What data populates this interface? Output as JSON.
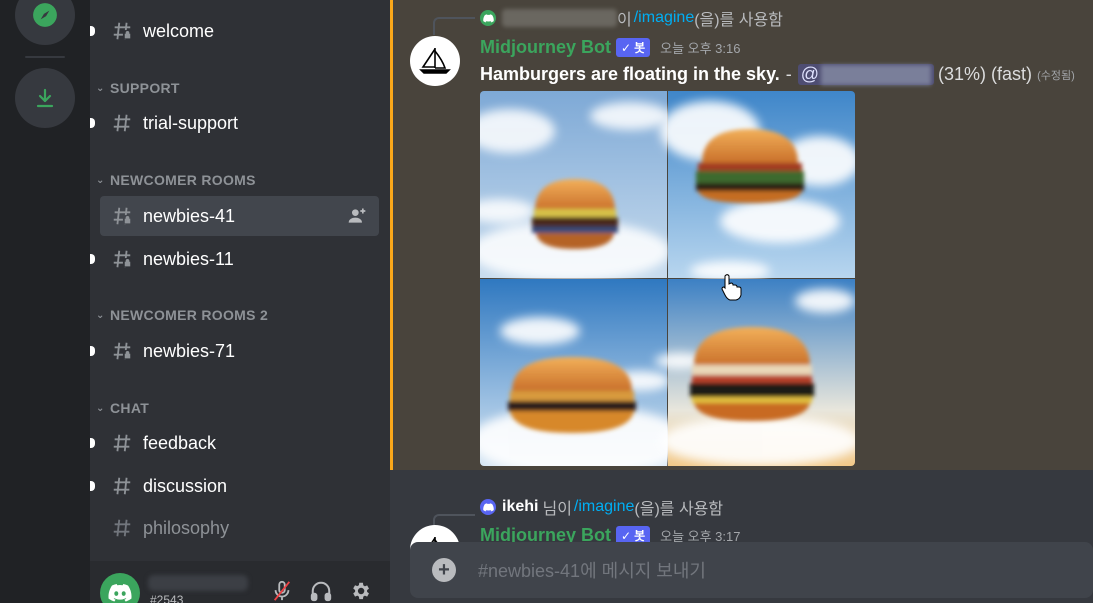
{
  "rail": {
    "explore_icon": "compass-icon",
    "download_icon": "download-icon"
  },
  "sidebar": {
    "channels_top": [
      {
        "name": "welcome"
      }
    ],
    "categories": [
      {
        "label": "SUPPORT",
        "channels": [
          {
            "name": "trial-support"
          }
        ]
      },
      {
        "label": "NEWCOMER ROOMS",
        "channels": [
          {
            "name": "newbies-41"
          },
          {
            "name": "newbies-11"
          }
        ]
      },
      {
        "label": "NEWCOMER ROOMS 2",
        "channels": [
          {
            "name": "newbies-71"
          }
        ]
      },
      {
        "label": "CHAT",
        "channels": [
          {
            "name": "feedback"
          },
          {
            "name": "discussion"
          },
          {
            "name": "philosophy"
          }
        ]
      }
    ],
    "user": {
      "tag": "#2543"
    }
  },
  "chat": {
    "messages": [
      {
        "reply_suffix": "이",
        "reply_command": "/imagine",
        "reply_tail": "(을)를 사용함",
        "author": "Midjourney Bot",
        "bot_label": "봇",
        "time": "오늘 오후 3:16",
        "prompt": "Hamburgers are floating in the sky.",
        "dash": "-",
        "mention_at": "@",
        "status": "(31%) (fast)",
        "edited": "(수정됨)"
      },
      {
        "reply_user": "ikehi",
        "reply_suffix": "님이",
        "reply_command": "/imagine",
        "reply_tail": "(을)를 사용함",
        "author": "Midjourney Bot",
        "bot_label": "봇",
        "time": "오늘 오후 3:17"
      }
    ],
    "composer_placeholder": "#newbies-41에 메시지 보내기"
  },
  "colors": {
    "accent_green": "#3ba55d",
    "blurple": "#5865f2",
    "highlight_border": "#faa81a",
    "link": "#00aff4"
  }
}
